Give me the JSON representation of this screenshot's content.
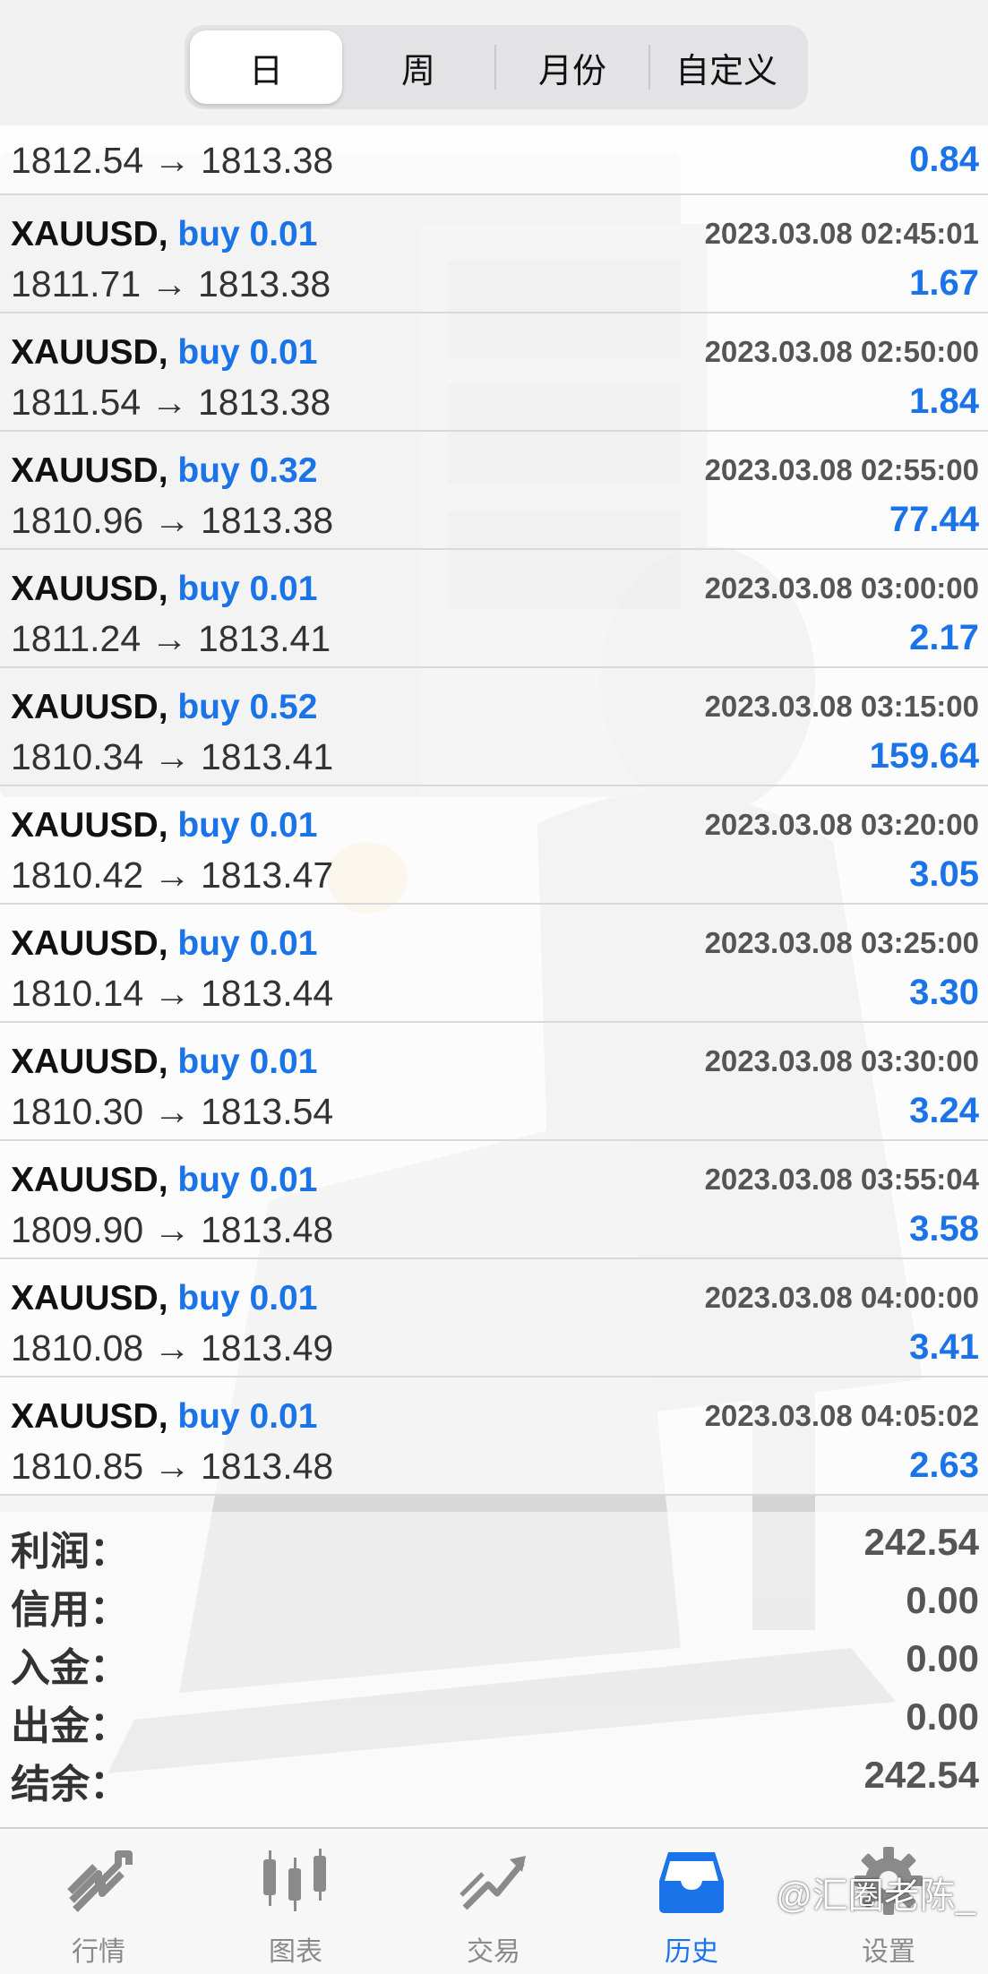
{
  "header": {
    "tabs": [
      "日",
      "周",
      "月份",
      "自定义"
    ],
    "active_tab": "日"
  },
  "partial_row": {
    "prices": "1812.54 → 1813.38",
    "profit": "0.84"
  },
  "trades": [
    {
      "symbol": "XAUUSD",
      "side": "buy 0.01",
      "time": "2023.03.08 02:45:01",
      "prices": "1811.71 → 1813.38",
      "profit": "1.67"
    },
    {
      "symbol": "XAUUSD",
      "side": "buy 0.01",
      "time": "2023.03.08 02:50:00",
      "prices": "1811.54 → 1813.38",
      "profit": "1.84"
    },
    {
      "symbol": "XAUUSD",
      "side": "buy 0.32",
      "time": "2023.03.08 02:55:00",
      "prices": "1810.96 → 1813.38",
      "profit": "77.44"
    },
    {
      "symbol": "XAUUSD",
      "side": "buy 0.01",
      "time": "2023.03.08 03:00:00",
      "prices": "1811.24 → 1813.41",
      "profit": "2.17"
    },
    {
      "symbol": "XAUUSD",
      "side": "buy 0.52",
      "time": "2023.03.08 03:15:00",
      "prices": "1810.34 → 1813.41",
      "profit": "159.64"
    },
    {
      "symbol": "XAUUSD",
      "side": "buy 0.01",
      "time": "2023.03.08 03:20:00",
      "prices": "1810.42 → 1813.47",
      "profit": "3.05"
    },
    {
      "symbol": "XAUUSD",
      "side": "buy 0.01",
      "time": "2023.03.08 03:25:00",
      "prices": "1810.14 → 1813.44",
      "profit": "3.30"
    },
    {
      "symbol": "XAUUSD",
      "side": "buy 0.01",
      "time": "2023.03.08 03:30:00",
      "prices": "1810.30 → 1813.54",
      "profit": "3.24"
    },
    {
      "symbol": "XAUUSD",
      "side": "buy 0.01",
      "time": "2023.03.08 03:55:04",
      "prices": "1809.90 → 1813.48",
      "profit": "3.58"
    },
    {
      "symbol": "XAUUSD",
      "side": "buy 0.01",
      "time": "2023.03.08 04:00:00",
      "prices": "1810.08 → 1813.49",
      "profit": "3.41"
    },
    {
      "symbol": "XAUUSD",
      "side": "buy 0.01",
      "time": "2023.03.08 04:05:02",
      "prices": "1810.85 → 1813.48",
      "profit": "2.63"
    }
  ],
  "summary": [
    {
      "label": "利润：",
      "value": "242.54"
    },
    {
      "label": "信用：",
      "value": "0.00"
    },
    {
      "label": "入金：",
      "value": "0.00"
    },
    {
      "label": "出金：",
      "value": "0.00"
    },
    {
      "label": "结余：",
      "value": "242.54"
    }
  ],
  "tabbar": [
    {
      "label": "行情",
      "icon": "quotes-arrows-icon",
      "active": false
    },
    {
      "label": "图表",
      "icon": "candlestick-chart-icon",
      "active": false
    },
    {
      "label": "交易",
      "icon": "trade-trend-icon",
      "active": false
    },
    {
      "label": "历史",
      "icon": "history-inbox-icon",
      "active": true
    },
    {
      "label": "设置",
      "icon": "gear-icon",
      "active": false
    }
  ],
  "watermark": "@汇圈老陈_",
  "colors": {
    "accent": "#1a73e8",
    "text": "#111111",
    "muted": "#8a8a8a",
    "divider": "#d9d9d9"
  }
}
